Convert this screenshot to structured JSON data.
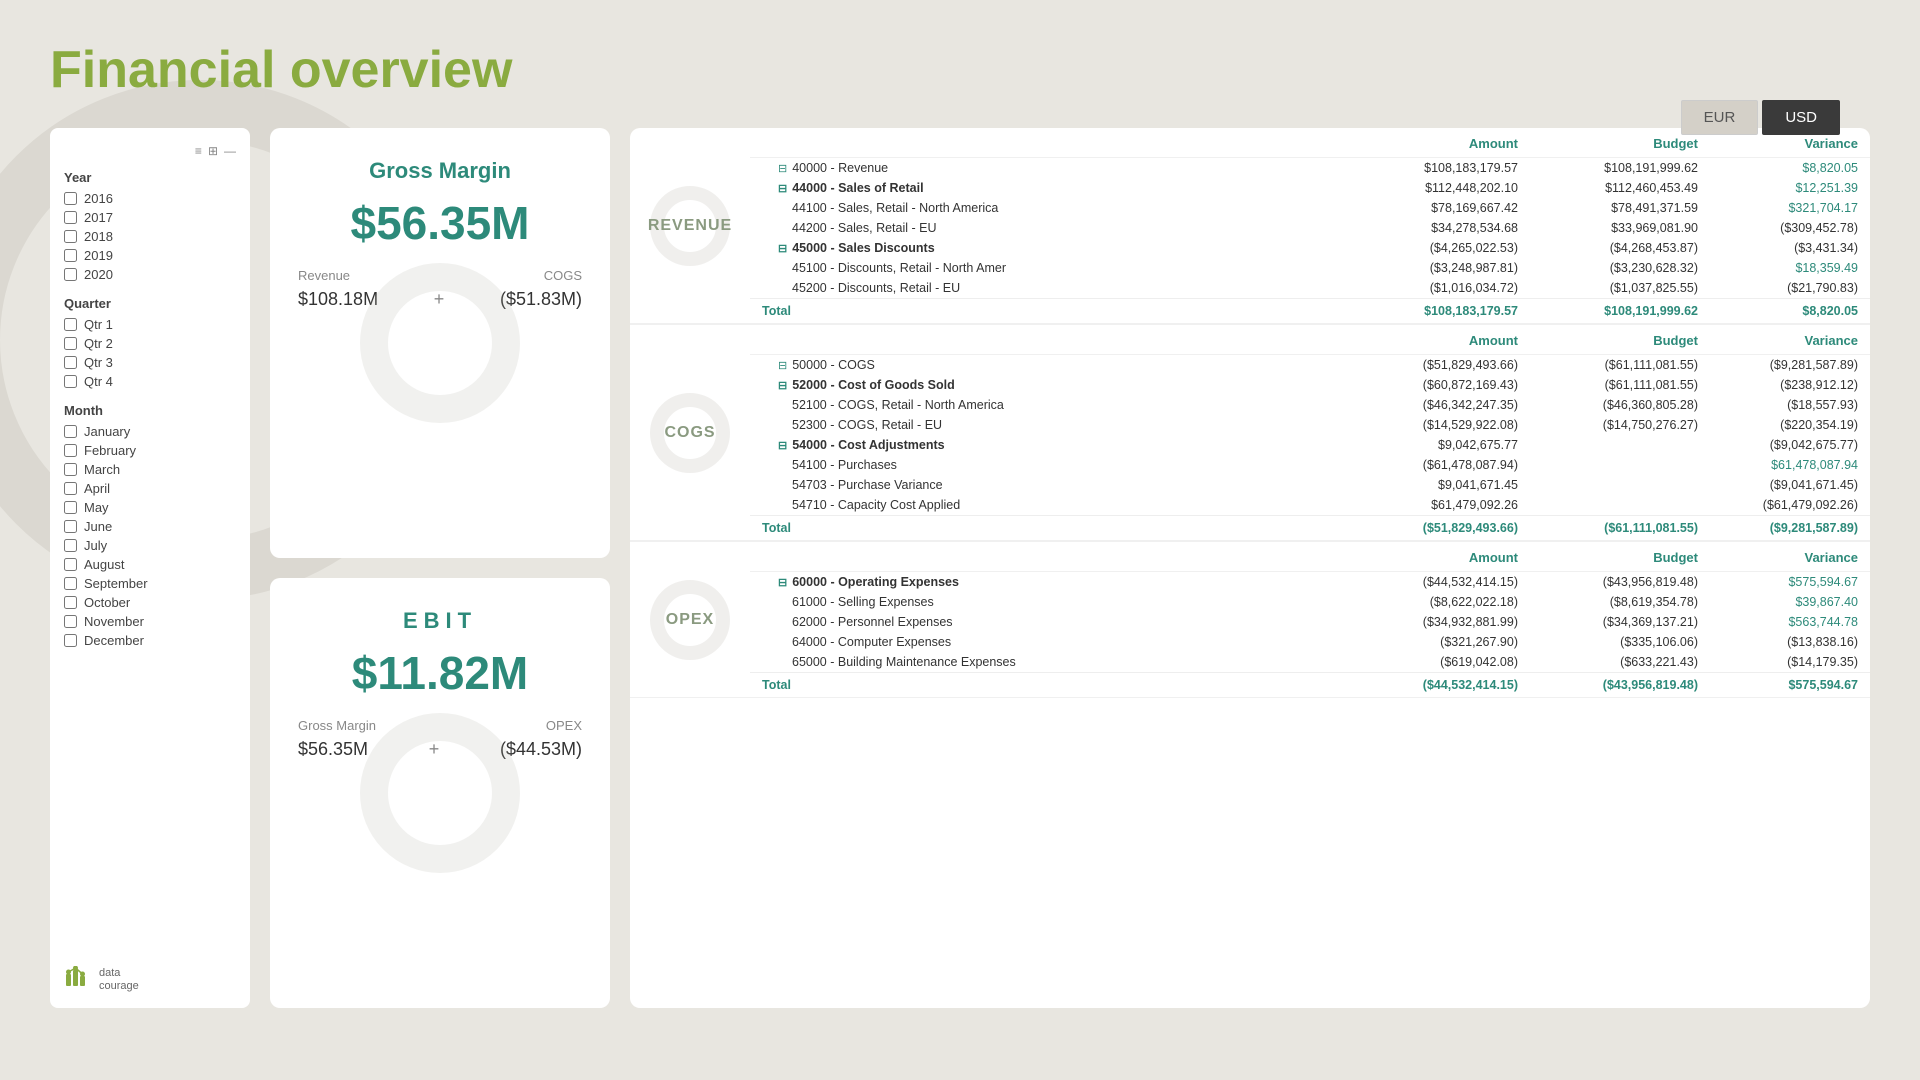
{
  "page": {
    "title": "Financial overview"
  },
  "currency": {
    "options": [
      "EUR",
      "USD"
    ],
    "active": "USD"
  },
  "filters": {
    "year": {
      "label": "Year",
      "options": [
        "2016",
        "2017",
        "2018",
        "2019",
        "2020"
      ]
    },
    "quarter": {
      "label": "Quarter",
      "options": [
        "Qtr 1",
        "Qtr 2",
        "Qtr 3",
        "Qtr 4"
      ]
    },
    "month": {
      "label": "Month",
      "options": [
        "January",
        "February",
        "March",
        "April",
        "May",
        "June",
        "July",
        "August",
        "September",
        "October",
        "November",
        "December"
      ]
    }
  },
  "kpi": {
    "gross_margin": {
      "title": "Gross Margin",
      "value": "$56.35M",
      "revenue_label": "Revenue",
      "cogs_label": "COGS",
      "revenue_value": "$108.18M",
      "cogs_value": "($51.83M)",
      "plus": "+"
    },
    "ebit": {
      "title": "EBIT",
      "value": "$11.82M",
      "gross_margin_label": "Gross Margin",
      "opex_label": "OPEX",
      "gross_margin_value": "$56.35M",
      "opex_value": "($44.53M)",
      "plus": "+"
    }
  },
  "revenue": {
    "section_label": "REVENUE",
    "col_amount": "Amount",
    "col_budget": "Budget",
    "col_variance": "Variance",
    "rows": [
      {
        "label": "40000 - Revenue",
        "indent": 1,
        "expand": true,
        "amount": "$108,183,179.57",
        "budget": "$108,191,999.62",
        "variance": "$8,820.05",
        "variance_color": "green"
      },
      {
        "label": "44000 - Sales of Retail",
        "indent": 1,
        "expand": true,
        "bold": true,
        "amount": "$112,448,202.10",
        "budget": "$112,460,453.49",
        "variance": "$12,251.39",
        "variance_color": "green"
      },
      {
        "label": "44100 - Sales, Retail - North America",
        "indent": 2,
        "amount": "$78,169,667.42",
        "budget": "$78,491,371.59",
        "variance": "$321,704.17",
        "variance_color": "green"
      },
      {
        "label": "44200 - Sales, Retail - EU",
        "indent": 2,
        "amount": "$34,278,534.68",
        "budget": "$33,969,081.90",
        "variance": "($309,452.78)",
        "variance_color": "neg"
      },
      {
        "label": "45000 - Sales Discounts",
        "indent": 1,
        "expand": true,
        "bold": true,
        "amount": "($4,265,022.53)",
        "budget": "($4,268,453.87)",
        "variance": "($3,431.34)",
        "variance_color": "neg"
      },
      {
        "label": "45100 - Discounts, Retail - North Amer",
        "indent": 2,
        "amount": "($3,248,987.81)",
        "budget": "($3,230,628.32)",
        "variance": "$18,359.49",
        "variance_color": "green"
      },
      {
        "label": "45200 - Discounts, Retail - EU",
        "indent": 2,
        "amount": "($1,016,034.72)",
        "budget": "($1,037,825.55)",
        "variance": "($21,790.83)",
        "variance_color": "neg"
      }
    ],
    "total": {
      "label": "Total",
      "amount": "$108,183,179.57",
      "budget": "$108,191,999.62",
      "variance": "$8,820.05"
    }
  },
  "cogs": {
    "section_label": "COGS",
    "col_amount": "Amount",
    "col_budget": "Budget",
    "col_variance": "Variance",
    "rows": [
      {
        "label": "50000 - COGS",
        "indent": 1,
        "expand": true,
        "amount": "($51,829,493.66)",
        "budget": "($61,111,081.55)",
        "variance": "($9,281,587.89)",
        "variance_color": "neg"
      },
      {
        "label": "52000 - Cost of Goods Sold",
        "indent": 1,
        "expand": true,
        "bold": true,
        "amount": "($60,872,169.43)",
        "budget": "($61,111,081.55)",
        "variance": "($238,912.12)",
        "variance_color": "neg"
      },
      {
        "label": "52100 - COGS, Retail - North America",
        "indent": 2,
        "amount": "($46,342,247.35)",
        "budget": "($46,360,805.28)",
        "variance": "($18,557.93)",
        "variance_color": "neg"
      },
      {
        "label": "52300 - COGS, Retail - EU",
        "indent": 2,
        "amount": "($14,529,922.08)",
        "budget": "($14,750,276.27)",
        "variance": "($220,354.19)",
        "variance_color": "neg"
      },
      {
        "label": "54000 - Cost Adjustments",
        "indent": 1,
        "expand": true,
        "bold": true,
        "amount": "$9,042,675.77",
        "budget": "",
        "variance": "($9,042,675.77)",
        "variance_color": "neg"
      },
      {
        "label": "54100 - Purchases",
        "indent": 2,
        "amount": "($61,478,087.94)",
        "budget": "",
        "variance": "$61,478,087.94",
        "variance_color": "green"
      },
      {
        "label": "54703 - Purchase Variance",
        "indent": 2,
        "amount": "$9,041,671.45",
        "budget": "",
        "variance": "($9,041,671.45)",
        "variance_color": "neg"
      },
      {
        "label": "54710 - Capacity Cost Applied",
        "indent": 2,
        "amount": "$61,479,092.26",
        "budget": "",
        "variance": "($61,479,092.26)",
        "variance_color": "neg"
      }
    ],
    "total": {
      "label": "Total",
      "amount": "($51,829,493.66)",
      "budget": "($61,111,081.55)",
      "variance": "($9,281,587.89)"
    }
  },
  "opex": {
    "section_label": "OPEX",
    "col_amount": "Amount",
    "col_budget": "Budget",
    "col_variance": "Variance",
    "rows": [
      {
        "label": "60000 - Operating Expenses",
        "indent": 1,
        "expand": true,
        "bold": true,
        "amount": "($44,532,414.15)",
        "budget": "($43,956,819.48)",
        "variance": "$575,594.67",
        "variance_color": "green"
      },
      {
        "label": "61000 - Selling Expenses",
        "indent": 2,
        "amount": "($8,622,022.18)",
        "budget": "($8,619,354.78)",
        "variance": "$39,867.40",
        "variance_color": "green"
      },
      {
        "label": "62000 - Personnel Expenses",
        "indent": 2,
        "amount": "($34,932,881.99)",
        "budget": "($34,369,137.21)",
        "variance": "$563,744.78",
        "variance_color": "green"
      },
      {
        "label": "64000 - Computer Expenses",
        "indent": 2,
        "amount": "($321,267.90)",
        "budget": "($335,106.06)",
        "variance": "($13,838.16)",
        "variance_color": "neg"
      },
      {
        "label": "65000 - Building Maintenance Expenses",
        "indent": 2,
        "amount": "($619,042.08)",
        "budget": "($633,221.43)",
        "variance": "($14,179.35)",
        "variance_color": "neg"
      }
    ],
    "total": {
      "label": "Total",
      "amount": "($44,532,414.15)",
      "budget": "($43,956,819.48)",
      "variance": "$575,594.67"
    }
  },
  "logo": {
    "text_line1": "data",
    "text_line2": "courage"
  }
}
